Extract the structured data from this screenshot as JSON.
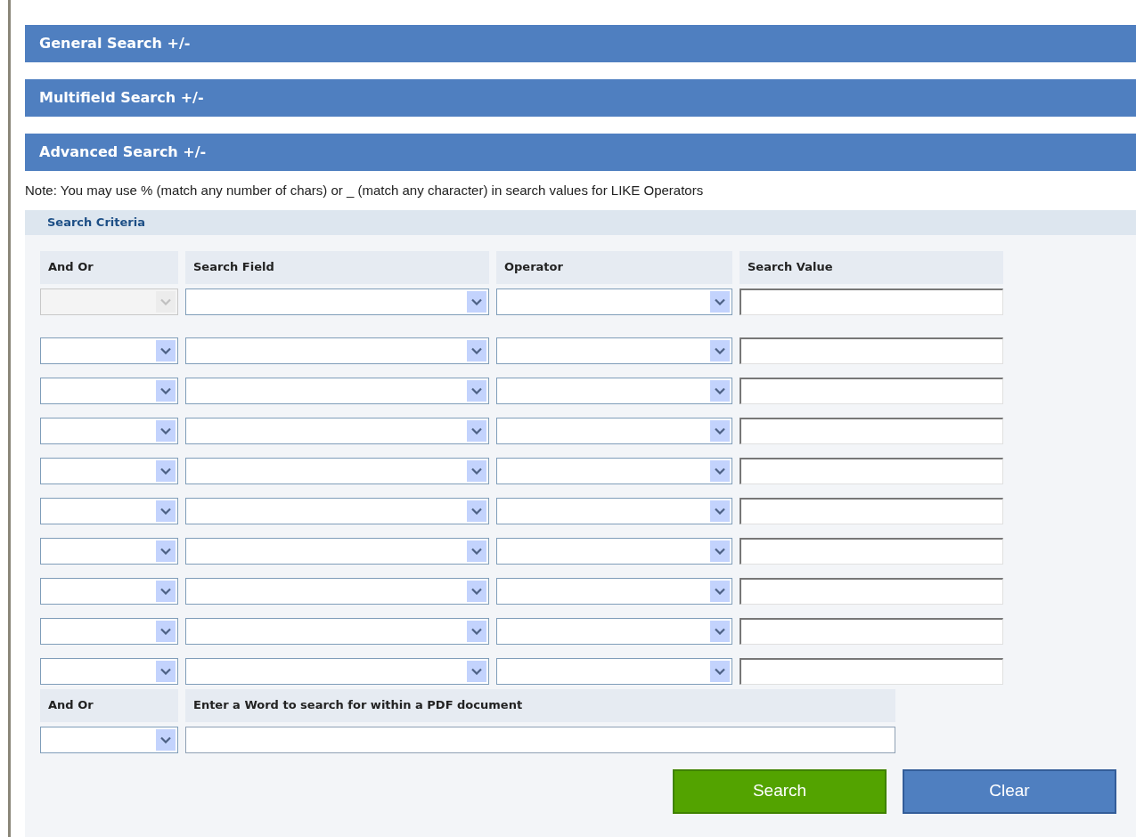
{
  "sections": [
    {
      "title": "General Search +/-"
    },
    {
      "title": "Multifield Search +/-"
    },
    {
      "title": "Advanced Search +/-"
    }
  ],
  "note": "Note: You may use % (match any number of chars) or _ (match any character) in search values for LIKE Operators",
  "criteria": {
    "title": "Search Criteria",
    "columns": [
      "And Or",
      "Search Field",
      "Operator",
      "Search Value"
    ],
    "rows": [
      {
        "and_or_disabled": true
      },
      {
        "and_or_disabled": false
      },
      {
        "and_or_disabled": false
      },
      {
        "and_or_disabled": false
      },
      {
        "and_or_disabled": false
      },
      {
        "and_or_disabled": false
      },
      {
        "and_or_disabled": false
      },
      {
        "and_or_disabled": false
      },
      {
        "and_or_disabled": false
      },
      {
        "and_or_disabled": false
      }
    ],
    "pdf_columns": [
      "And Or",
      "Enter a Word to search for within a PDF document"
    ]
  },
  "buttons": [
    {
      "label": "Search",
      "kind": "primary"
    },
    {
      "label": "Clear",
      "kind": "secondary"
    }
  ]
}
